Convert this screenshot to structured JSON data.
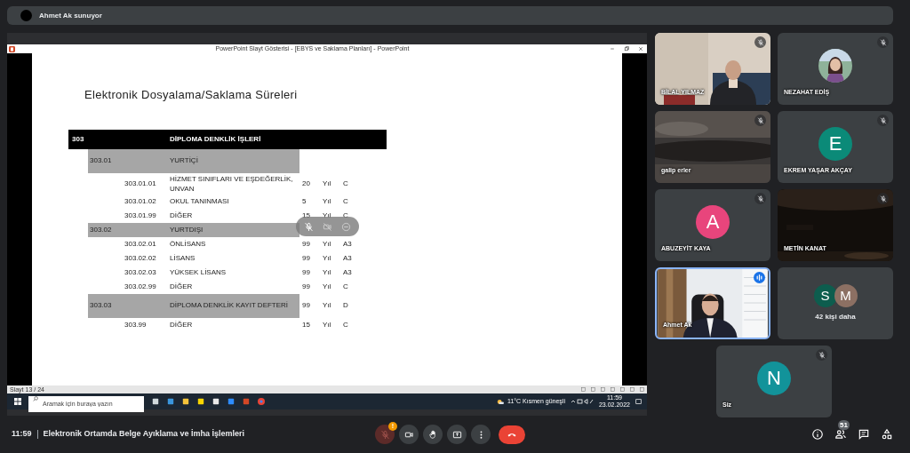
{
  "presenter_banner": {
    "text": "Ahmet Ak sunuyor"
  },
  "shared_screen": {
    "window_title": "PowerPoint Slayt Gösterisi - [EBYS ve Saklama Planları] - PowerPoint",
    "slide": {
      "title": "Elektronik Dosyalama/Saklama Süreleri",
      "rows": [
        {
          "kind": "header",
          "code": "303",
          "title": "DİPLOMA DENKLİK İŞLERİ"
        },
        {
          "kind": "group",
          "code": "303.01",
          "title": "YURTİÇİ"
        },
        {
          "kind": "item",
          "code": "303.01.01",
          "title": "HİZMET SINIFLARI VE EŞDEĞERLİK, UNVAN",
          "years": "20",
          "unit": "Yıl",
          "class": "C"
        },
        {
          "kind": "item",
          "code": "303.01.02",
          "title": "OKUL TANINMASI",
          "years": "5",
          "unit": "Yıl",
          "class": "C"
        },
        {
          "kind": "item",
          "code": "303.01.99",
          "title": "DİĞER",
          "years": "15",
          "unit": "Yıl",
          "class": "C"
        },
        {
          "kind": "group",
          "code": "303.02",
          "title": "YURTDIŞI"
        },
        {
          "kind": "item",
          "code": "303.02.01",
          "title": "ÖNLİSANS",
          "years": "99",
          "unit": "Yıl",
          "class": "A3"
        },
        {
          "kind": "item",
          "code": "303.02.02",
          "title": "LİSANS",
          "years": "99",
          "unit": "Yıl",
          "class": "A3"
        },
        {
          "kind": "item",
          "code": "303.02.03",
          "title": "YÜKSEK LİSANS",
          "years": "99",
          "unit": "Yıl",
          "class": "A3"
        },
        {
          "kind": "item",
          "code": "303.02.99",
          "title": "DİĞER",
          "years": "99",
          "unit": "Yıl",
          "class": "C"
        },
        {
          "kind": "group",
          "code": "303.03",
          "title": "DİPLOMA DENKLİK KAYIT DEFTERİ",
          "years": "99",
          "unit": "Yıl",
          "class": "D"
        },
        {
          "kind": "item",
          "code": "303.99",
          "title": "DİĞER",
          "years": "15",
          "unit": "Yıl",
          "class": "C"
        }
      ]
    },
    "status_bar": {
      "slide_counter": "Slayt 13 / 24"
    },
    "taskbar": {
      "search_placeholder": "Aramak için buraya yazın",
      "weather": "11°C Kısmen güneşli",
      "time": "11:59",
      "date": "23.02.2022"
    }
  },
  "tiles": [
    {
      "kind": "video",
      "name": "BİLAL YILMAZ",
      "muted": true,
      "speaking": false
    },
    {
      "kind": "photo_avatar",
      "name": "NEZAHAT EDİŞ",
      "muted": true,
      "speaking": false
    },
    {
      "kind": "video",
      "name": "galip erler",
      "muted": true,
      "speaking": false
    },
    {
      "kind": "avatar",
      "letter": "E",
      "color": "#0b8a78",
      "name": "EKREM YAŞAR AKÇAY",
      "muted": true,
      "speaking": false
    },
    {
      "kind": "avatar",
      "letter": "A",
      "color": "#e8457c",
      "name": "ABUZEYİT KAYA",
      "muted": true,
      "speaking": false
    },
    {
      "kind": "video",
      "name": "METİN KANAT",
      "muted": true,
      "speaking": false
    },
    {
      "kind": "video",
      "name": "Ahmet Ak",
      "muted": false,
      "speaking": true
    },
    {
      "kind": "others",
      "avatars": [
        {
          "letter": "S",
          "color": "#0d5d4e"
        },
        {
          "letter": "M",
          "color": "#8c7063"
        }
      ],
      "label": "42 kişi daha"
    },
    {
      "kind": "avatar",
      "letter": "N",
      "color": "#12939a",
      "name": "Siz",
      "muted": true,
      "speaking": false
    }
  ],
  "bottom_bar": {
    "time": "11:59",
    "meeting_title": "Elektronik Ortamda Belge Ayıklama ve İmha İşlemleri",
    "mic_muted": true,
    "mic_alert": "!",
    "people_count": "51"
  }
}
